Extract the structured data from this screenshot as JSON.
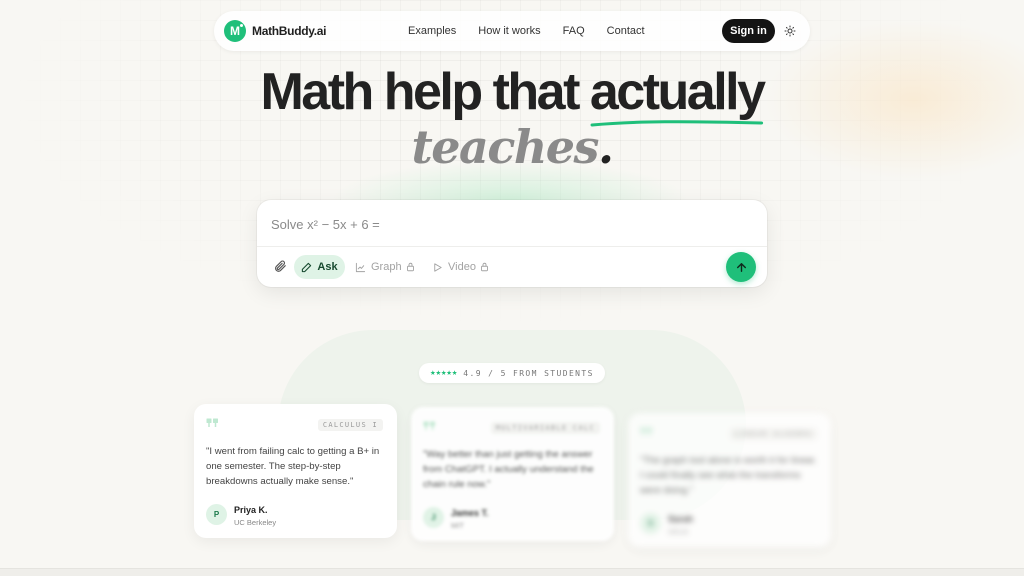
{
  "brand": {
    "name": "MathBuddy.ai",
    "logo_letter": "M",
    "accent_color": "#1fbf7a"
  },
  "nav": {
    "links": [
      "Examples",
      "How it works",
      "FAQ",
      "Contact"
    ],
    "signin_label": "Sign in",
    "theme_icon": "sun-icon"
  },
  "hero": {
    "line1_prefix": "Math help that ",
    "line1_accent": "actually",
    "line2_word": "teaches",
    "line2_dot": "."
  },
  "ask": {
    "placeholder": "Solve x² − 5x + 6 =",
    "attach_icon": "paperclip-icon",
    "modes": [
      {
        "label": "Ask",
        "icon": "pencil-icon",
        "active": true,
        "locked": false
      },
      {
        "label": "Graph",
        "icon": "chart-line-icon",
        "active": false,
        "locked": true
      },
      {
        "label": "Video",
        "icon": "play-icon",
        "active": false,
        "locked": true
      }
    ],
    "send_icon": "arrow-up-icon"
  },
  "rating": {
    "stars": "★★★★★",
    "text": "4.9 / 5 FROM STUDENTS"
  },
  "testimonials": [
    {
      "tag": "CALCULUS I",
      "quote": "\"I went from failing calc to getting a B+ in one semester. The step-by-step breakdowns actually make sense.\"",
      "initial": "P",
      "name": "Priya K.",
      "school": "UC Berkeley"
    },
    {
      "tag": "MULTIVARIABLE CALC",
      "quote": "\"Way better than just getting the answer from ChatGPT. I actually understand the chain rule now.\"",
      "initial": "J",
      "name": "James T.",
      "school": "MIT"
    },
    {
      "tag": "LINEAR ALGEBRA",
      "quote": "\"The graph tool alone is worth it for linear. I could finally see what the transforms were doing.\"",
      "initial": "S",
      "name": "Sarah",
      "school": "UCLA"
    }
  ]
}
